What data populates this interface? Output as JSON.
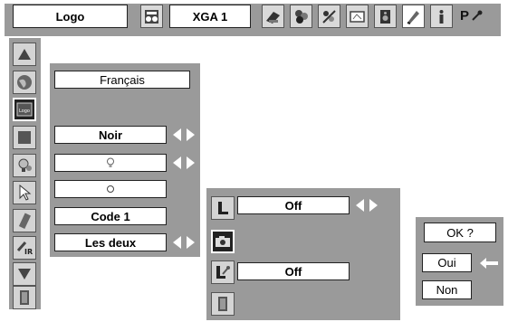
{
  "topbar": {
    "logo_label": "Logo",
    "source_label": "XGA 1",
    "p_glyph": "P"
  },
  "main": {
    "language": "Français",
    "background": "Noir",
    "field3": "",
    "field4": "",
    "logo_select": "Code 1",
    "display": "Les deux"
  },
  "sub": {
    "row1_value": "Off",
    "row3_value": "Off"
  },
  "confirm": {
    "question": "OK ?",
    "yes": "Oui",
    "no": "Non"
  },
  "colors": {
    "panel": "#9a9a9a",
    "field": "#ffffff",
    "arrow": "#ffffff"
  }
}
